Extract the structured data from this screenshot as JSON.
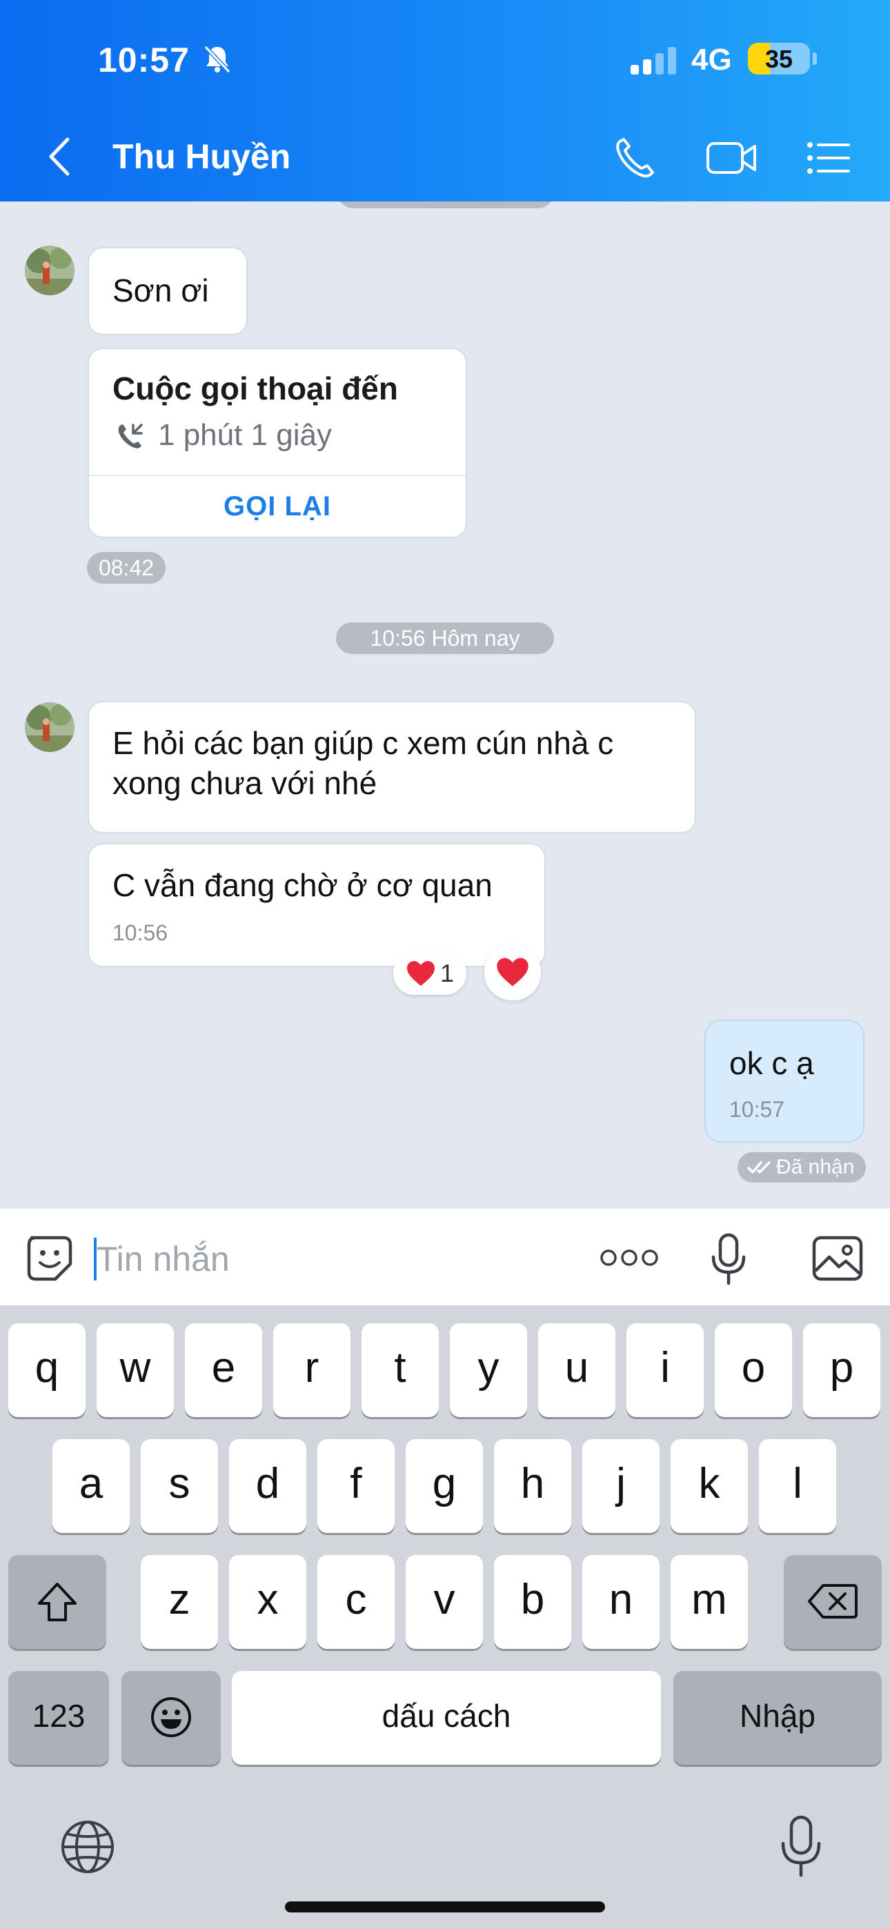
{
  "status_bar": {
    "time": "10:57",
    "network": "4G",
    "battery": "35",
    "battery_level": 0.35
  },
  "header": {
    "contact_name": "Thu Huyền"
  },
  "messages": {
    "m1": "Sơn ơi",
    "call": {
      "title": "Cuộc gọi thoại đến",
      "duration": "1 phút 1 giây",
      "action": "GỌI LẠI"
    },
    "call_time": "08:42",
    "date_divider": "10:56 Hôm nay",
    "m2": "E hỏi các bạn giúp c xem cún nhà c xong chưa với nhé",
    "m3": {
      "text": "C vẫn đang chờ ở cơ quan",
      "time": "10:56",
      "reaction_count": "1"
    },
    "sent": {
      "text": "ok c ạ",
      "time": "10:57",
      "status": "Đã nhận"
    }
  },
  "composer": {
    "placeholder": "Tin nhắn"
  },
  "keyboard": {
    "row1": [
      "q",
      "w",
      "e",
      "r",
      "t",
      "y",
      "u",
      "i",
      "o",
      "p"
    ],
    "row2": [
      "a",
      "s",
      "d",
      "f",
      "g",
      "h",
      "j",
      "k",
      "l"
    ],
    "row3": [
      "z",
      "x",
      "c",
      "v",
      "b",
      "n",
      "m"
    ],
    "numbers": "123",
    "space": "dấu cách",
    "return": "Nhập"
  }
}
